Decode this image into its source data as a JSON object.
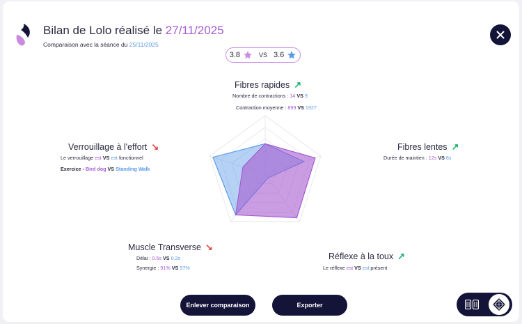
{
  "header": {
    "title_prefix": "Bilan de Lolo réalisé le ",
    "title_date": "27/11/2025",
    "subtitle_prefix": "Comparaison avec la séance du ",
    "subtitle_date": "25/11/2025"
  },
  "score": {
    "current": "3.8",
    "vs": "VS",
    "previous": "3.6",
    "current_icon": "star-icon",
    "previous_icon": "star-icon"
  },
  "metrics": {
    "fibres_rapides": {
      "label": "Fibres rapides",
      "trend": "up",
      "line1_label": "Nombre de contractions :",
      "line1_current": "14",
      "line1_previous": "9",
      "line2_label": "Contraction moyenne :",
      "line2_current": "899",
      "line2_previous": "1927"
    },
    "fibres_lentes": {
      "label": "Fibres lentes",
      "trend": "up",
      "line1_label": "Durée de maintien :",
      "line1_current": "12s",
      "line1_previous": "8s"
    },
    "reflexe_toux": {
      "label": "Réflexe à la toux",
      "trend": "up",
      "line1_label": "Le réflexe",
      "line1_current": "est",
      "line1_previous": "est",
      "line1_suffix": "présent"
    },
    "muscle_transverse": {
      "label": "Muscle Transverse",
      "trend": "down",
      "line1_label": "Délai :",
      "line1_current": "0.5s",
      "line1_previous": "0.2s",
      "line2_label": "Synergie :",
      "line2_current": "91%",
      "line2_previous": "97%"
    },
    "verrouillage": {
      "label": "Verrouillage à l'effort",
      "trend": "down",
      "line1_label": "Le verrouillage",
      "line1_current": "est",
      "line1_previous": "est",
      "line1_suffix": "fonctionnel",
      "line2_label": "Exercice -",
      "line2_current": "Bird dog",
      "line2_previous": "Standing Walk"
    }
  },
  "vs_word": "VS",
  "buttons": {
    "remove_comparison": "Enlever comparaison",
    "export": "Exporter"
  },
  "colors": {
    "current": "#a65bd1",
    "previous": "#5a9be8",
    "dark": "#131438",
    "trend_up": "#19b36b",
    "trend_down": "#e0443a"
  },
  "chart_data": {
    "type": "radar",
    "axes": [
      "Fibres rapides",
      "Fibres lentes",
      "Réflexe à la toux",
      "Muscle Transverse",
      "Verrouillage à l'effort"
    ],
    "rlim": [
      0,
      5
    ],
    "series": [
      {
        "values": [
          2.6,
          4.5,
          4.6,
          4.3,
          2.0
        ],
        "color": "#a65bd1"
      },
      {
        "values": [
          2.6,
          3.5,
          0.4,
          4.3,
          4.7
        ],
        "color": "#5a9be8"
      }
    ]
  }
}
